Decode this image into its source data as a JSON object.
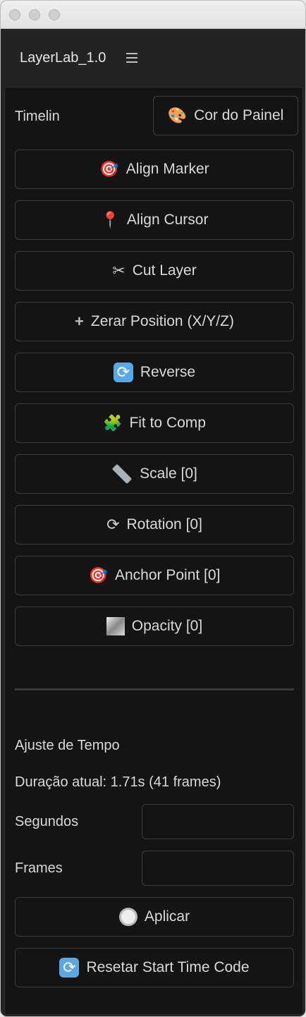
{
  "window": {
    "title": ""
  },
  "panel": {
    "name": "LayerLab_1.0",
    "menu_icon": "hamburger-icon"
  },
  "top": {
    "timeline_label": "Timelin",
    "color_button": {
      "icon": "palette-icon",
      "label": "Cor do Painel"
    }
  },
  "buttons": [
    {
      "icon": "target-icon",
      "label": "Align Marker"
    },
    {
      "icon": "pin-icon",
      "label": "Align Cursor"
    },
    {
      "icon": "scissors-icon",
      "label": "Cut Layer"
    },
    {
      "icon": "plus-icon",
      "label": "Zerar Position (X/Y/Z)"
    },
    {
      "icon": "cycle-icon",
      "label": "Reverse"
    },
    {
      "icon": "puzzle-icon",
      "label": "Fit to Comp"
    },
    {
      "icon": "ruler-icon",
      "label": "Scale [0]"
    },
    {
      "icon": "rotate-icon",
      "label": "Rotation [0]"
    },
    {
      "icon": "target-icon",
      "label": "Anchor Point [0]"
    },
    {
      "icon": "opacity-icon",
      "label": "Opacity [0]"
    }
  ],
  "time": {
    "section_title": "Ajuste de Tempo",
    "duration_text": "Duração atual: 1.71s (41 frames)",
    "seconds_label": "Segundos",
    "seconds_value": "",
    "frames_label": "Frames",
    "frames_value": "",
    "apply_button": {
      "icon": "stopwatch-icon",
      "label": "Aplicar"
    },
    "reset_button": {
      "icon": "cycle-icon",
      "label": "Resetar Start Time Code"
    }
  },
  "colors": {
    "background": "#141414",
    "border": "#3d3d3d",
    "text": "#d9d9d9"
  }
}
